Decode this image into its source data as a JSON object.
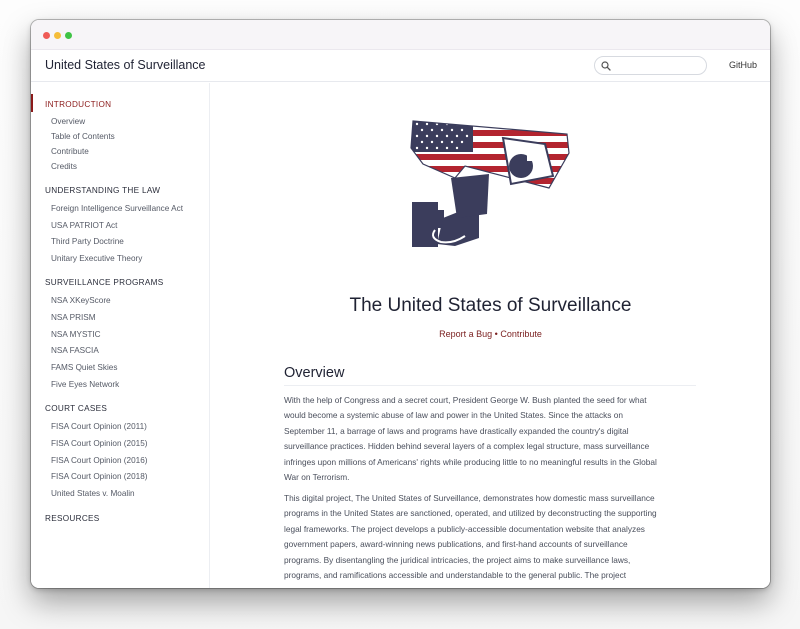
{
  "header": {
    "site_title": "United States of Surveillance",
    "search_placeholder": "",
    "github_label": "GitHub"
  },
  "sidebar": {
    "sections": [
      {
        "title": "INTRODUCTION",
        "active": true,
        "items": [
          "Overview",
          "Table of Contents",
          "Contribute",
          "Credits"
        ]
      },
      {
        "title": "UNDERSTANDING THE LAW",
        "items": [
          "Foreign Intelligence Surveillance Act",
          "USA PATRIOT Act",
          "Third Party Doctrine",
          "Unitary Executive Theory"
        ]
      },
      {
        "title": "SURVEILLANCE PROGRAMS",
        "items": [
          "NSA XKeyScore",
          "NSA PRISM",
          "NSA MYSTIC",
          "NSA FASCIA",
          "FAMS Quiet Skies",
          "Five Eyes Network"
        ]
      },
      {
        "title": "COURT CASES",
        "items": [
          "FISA Court Opinion (2011)",
          "FISA Court Opinion (2015)",
          "FISA Court Opinion (2016)",
          "FISA Court Opinion (2018)",
          "United States v. Moalin"
        ]
      },
      {
        "title": "RESOURCES",
        "items": []
      }
    ]
  },
  "main": {
    "title": "The United States of Surveillance",
    "links": {
      "report_bug": "Report a Bug",
      "separator": "•",
      "contribute": "Contribute"
    },
    "overview_heading": "Overview",
    "paragraph1_lines": [
      "With the help of Congress and a secret court, President George W. Bush planted the seed for what",
      "would become a systemic abuse of law and power in the United States. Since the attacks on",
      "September 11, a barrage of laws and programs have drastically expanded the country's digital",
      "surveillance practices. Hidden behind several layers of a complex legal structure, mass surveillance",
      "infringes upon millions of Americans' rights while producing little to no meaningful results in the Global",
      "War on Terrorism."
    ],
    "paragraph2_lines": [
      "This digital project, The United States of Surveillance, demonstrates how domestic mass surveillance",
      "programs in the United States are sanctioned, operated, and utilized by deconstructing the supporting",
      "legal frameworks. The project develops a publicly-accessible documentation website that analyzes",
      "government papers, award-winning news publications, and first-hand accounts of surveillance",
      "programs. By disentangling the juridical intricacies, the project aims to make surveillance laws,",
      "programs, and ramifications accessible and understandable to the general public. The project"
    ]
  },
  "colors": {
    "accent": "#8b1a1a",
    "navy": "#3b3d5c",
    "flag_red": "#b3242f"
  },
  "icons": [
    "search-icon",
    "surveillance-camera-flag-logo"
  ]
}
